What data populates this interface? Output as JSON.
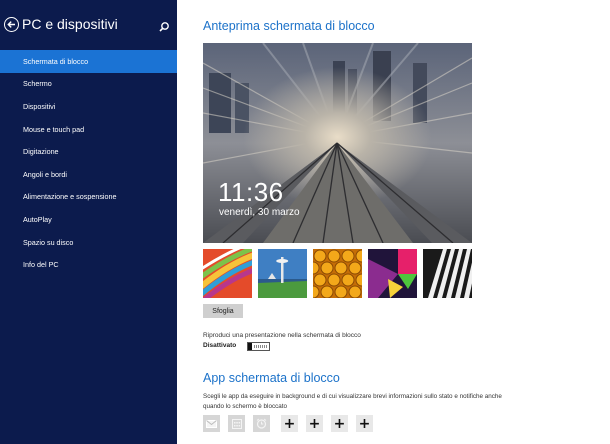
{
  "sidebar": {
    "title": "PC e dispositivi",
    "items": [
      {
        "label": "Schermata di blocco",
        "active": true
      },
      {
        "label": "Schermo",
        "active": false
      },
      {
        "label": "Dispositivi",
        "active": false
      },
      {
        "label": "Mouse e touch pad",
        "active": false
      },
      {
        "label": "Digitazione",
        "active": false
      },
      {
        "label": "Angoli e bordi",
        "active": false
      },
      {
        "label": "Alimentazione e sospensione",
        "active": false
      },
      {
        "label": "AutoPlay",
        "active": false
      },
      {
        "label": "Spazio su disco",
        "active": false
      },
      {
        "label": "Info del PC",
        "active": false
      }
    ]
  },
  "preview": {
    "title": "Anteprima schermata di blocco",
    "time": "11:36",
    "date": "venerdì, 30 marzo"
  },
  "browse_label": "Sfoglia",
  "slideshow": {
    "label": "Riproduci una presentazione nella schermata di blocco",
    "state": "Disattivato"
  },
  "apps": {
    "title": "App schermata di blocco",
    "description": "Scegli le app da eseguire in background e di cui visualizzare brevi informazioni sullo stato e notifiche anche quando lo schermo è bloccato",
    "slots": [
      "mail-icon",
      "calendar-icon",
      "alarm-icon",
      "add",
      "add",
      "add",
      "add"
    ],
    "add_symbol": "+"
  },
  "colors": {
    "sidebar_bg": "#0c1b4d",
    "active_item": "#1b73d4",
    "accent": "#1c72c9"
  }
}
